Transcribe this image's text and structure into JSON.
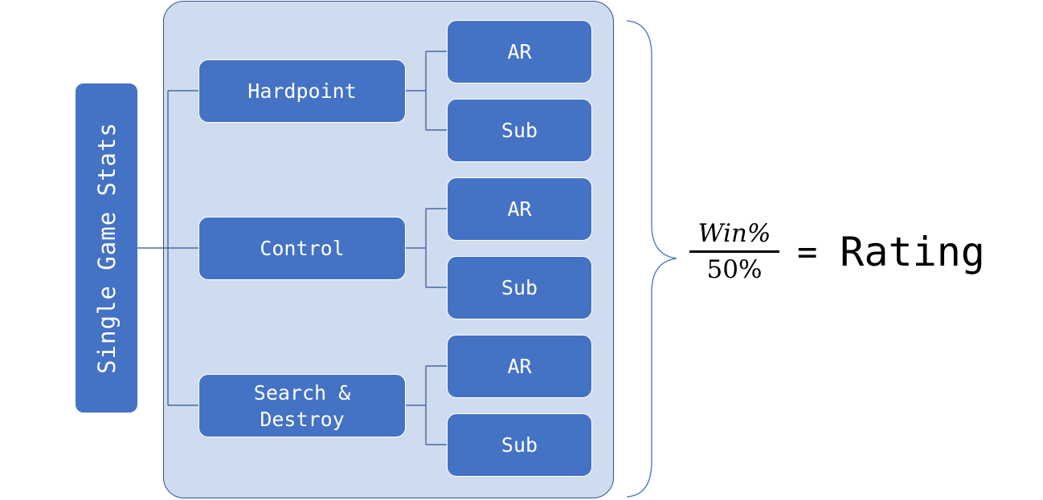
{
  "root": {
    "label": "Single Game Stats"
  },
  "modes": [
    {
      "label": "Hardpoint",
      "children": [
        {
          "label": "AR"
        },
        {
          "label": "Sub"
        }
      ]
    },
    {
      "label": "Control",
      "children": [
        {
          "label": "AR"
        },
        {
          "label": "Sub"
        }
      ]
    },
    {
      "label": "Search & Destroy",
      "children": [
        {
          "label": "AR"
        },
        {
          "label": "Sub"
        }
      ]
    }
  ],
  "formula": {
    "numerator": "Win%",
    "denominator": "50%",
    "equals": "=",
    "result": "Rating"
  },
  "colors": {
    "box_fill": "#4472c4",
    "panel_fill": "#cfdcef",
    "line": "#2f528f",
    "brace": "#4472c4"
  }
}
